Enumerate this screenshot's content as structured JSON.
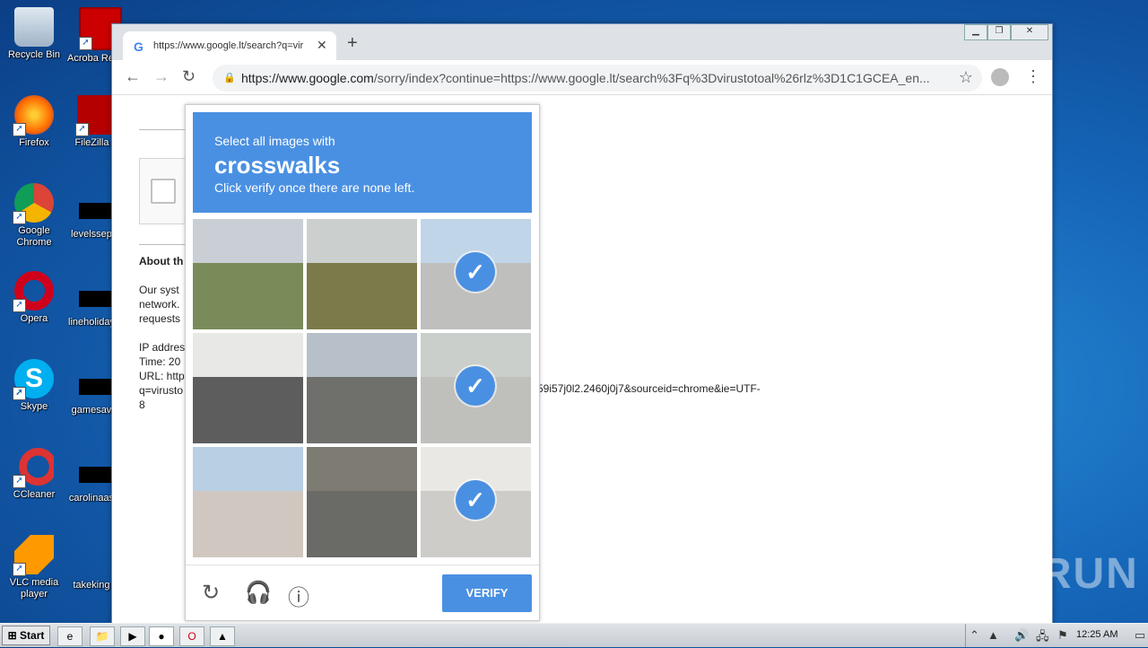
{
  "desktop": {
    "icons": [
      {
        "label": "Recycle Bin"
      },
      {
        "label": "Acroba Reader"
      },
      {
        "label": "Firefox"
      },
      {
        "label": "FileZilla C"
      },
      {
        "label": "Google Chrome"
      },
      {
        "label": "levelssep"
      },
      {
        "label": "Opera"
      },
      {
        "label": "lineholiday"
      },
      {
        "label": "Skype"
      },
      {
        "label": "gamesav"
      },
      {
        "label": "CCleaner"
      },
      {
        "label": "carolinaas"
      },
      {
        "label": "VLC media player"
      },
      {
        "label": "takeking"
      }
    ]
  },
  "browser": {
    "tab_title": "https://www.google.lt/search?q=vir",
    "url_host": "https://www.google.com",
    "url_path": "/sorry/index?continue=https://www.google.lt/search%3Fq%3Dvirustotoal%26rlz%3D1C1GCEA_en..."
  },
  "page": {
    "about_heading": "About th",
    "para1": [
      "Our syst",
      "network.",
      "requests"
    ],
    "para2": [
      "IP addres",
      "Time: 20",
      "URL: http",
      "q=virusto",
      "8"
    ],
    "url_rest": "59i57j0l2.2460j0j7&sourceid=chrome&ie=UTF-"
  },
  "captcha": {
    "line1": "Select all images with",
    "keyword": "crosswalks",
    "line3": "Click verify once there are none left.",
    "verify_label": "VERIFY",
    "tiles": [
      {
        "sky": "#c9cfd4",
        "ground": "#7a8b5a",
        "selected": false
      },
      {
        "sky": "#cbd0cf",
        "ground": "#7c7a4a",
        "selected": false
      },
      {
        "sky": "#8fb2d6",
        "ground": "#8b8b88",
        "selected": true
      },
      {
        "sky": "#e8e8e6",
        "ground": "#5d5d5d",
        "selected": false
      },
      {
        "sky": "#b7c0c8",
        "ground": "#6f6f6c",
        "selected": false
      },
      {
        "sky": "#9ea8a0",
        "ground": "#8a8a86",
        "selected": true
      },
      {
        "sky": "#b8cfe4",
        "ground": "#d0c8c0",
        "selected": false
      },
      {
        "sky": "#7e7c72",
        "ground": "#6a6a66",
        "selected": false
      },
      {
        "sky": "#d8d6d0",
        "ground": "#a4a29c",
        "selected": true
      }
    ]
  },
  "watermark": "ANY RUN",
  "taskbar": {
    "start_label": "Start",
    "clock": "12:25 AM"
  }
}
